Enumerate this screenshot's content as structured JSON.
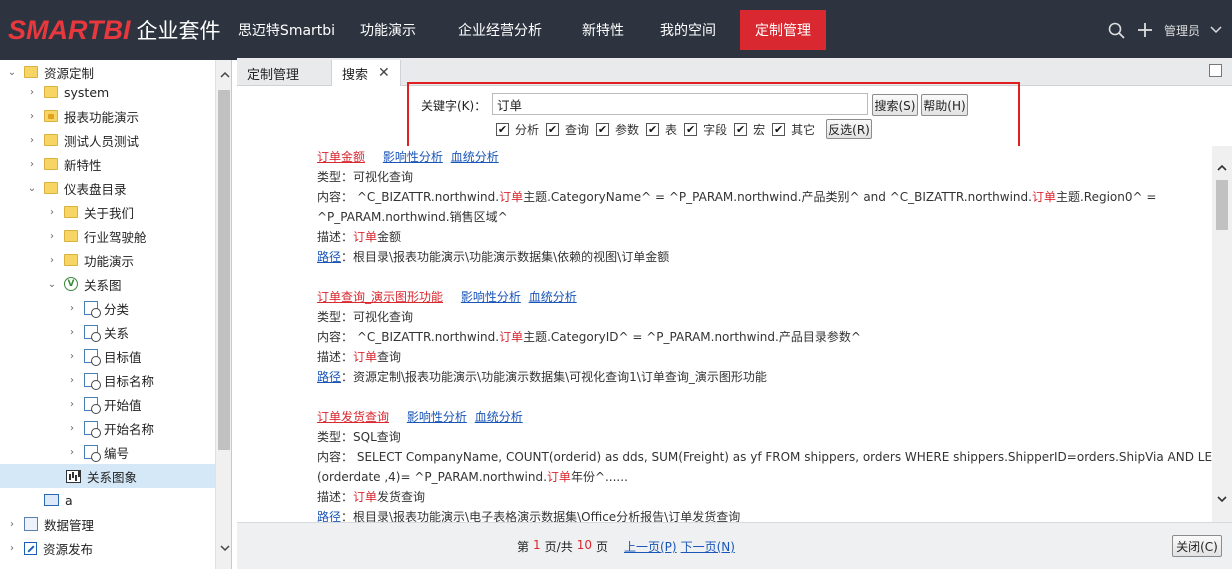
{
  "header": {
    "logo_brand": "SMARTBI",
    "logo_suffix": "企业套件",
    "nav": [
      {
        "label": "思迈特Smartbi",
        "active": false
      },
      {
        "label": "功能演示",
        "active": false
      },
      {
        "label": "企业经营分析",
        "active": false
      },
      {
        "label": "新特性",
        "active": false
      },
      {
        "label": "我的空间",
        "active": false
      },
      {
        "label": "定制管理",
        "active": true
      }
    ],
    "user": "管理员",
    "accent_color": "#d9282f",
    "bar_color": "#2d3440"
  },
  "tree": {
    "items": [
      {
        "label": "资源定制",
        "icon": "folder-icon",
        "expanded": true
      },
      {
        "label": "system",
        "icon": "folder-icon"
      },
      {
        "label": "报表功能演示",
        "icon": "locked-folder-icon"
      },
      {
        "label": "测试人员测试",
        "icon": "folder-icon"
      },
      {
        "label": "新特性",
        "icon": "folder-icon"
      },
      {
        "label": "仪表盘目录",
        "icon": "folder-icon",
        "expanded": true
      },
      {
        "label": "关于我们",
        "icon": "folder-icon"
      },
      {
        "label": "行业驾驶舱",
        "icon": "folder-icon"
      },
      {
        "label": "功能演示",
        "icon": "folder-icon"
      },
      {
        "label": "关系图",
        "icon": "visualization-icon",
        "expanded": true
      },
      {
        "label": "分类",
        "icon": "query-icon"
      },
      {
        "label": "关系",
        "icon": "query-icon"
      },
      {
        "label": "目标值",
        "icon": "query-icon"
      },
      {
        "label": "目标名称",
        "icon": "query-icon"
      },
      {
        "label": "开始值",
        "icon": "query-icon"
      },
      {
        "label": "开始名称",
        "icon": "query-icon"
      },
      {
        "label": "编号",
        "icon": "query-icon"
      },
      {
        "label": "关系图象",
        "icon": "chart-icon",
        "selected": true
      },
      {
        "label": "a",
        "icon": "report-icon"
      },
      {
        "label": "数据管理",
        "icon": "document-icon"
      },
      {
        "label": "资源发布",
        "icon": "publish-icon"
      }
    ]
  },
  "tabs": [
    {
      "label": "定制管理",
      "active": false
    },
    {
      "label": "搜索",
      "active": true
    }
  ],
  "search": {
    "keyword_label": "关键字(K)：",
    "keyword_value": "订单",
    "search_button": "搜索(S)",
    "help_button": "帮助(H)",
    "invert_button": "反选(R)",
    "options": [
      {
        "label": "分析",
        "checked": true
      },
      {
        "label": "查询",
        "checked": true
      },
      {
        "label": "参数",
        "checked": true
      },
      {
        "label": "表",
        "checked": true
      },
      {
        "label": "字段",
        "checked": true
      },
      {
        "label": "宏",
        "checked": true
      },
      {
        "label": "其它",
        "checked": true
      }
    ]
  },
  "results": [
    {
      "title": "订单金额",
      "impact_link": "影响性分析",
      "lineage_link": "血统分析",
      "type_label": "类型：",
      "type_value": "可视化查询",
      "content_label": "内容：",
      "content_1": " ^C_BIZATTR.northwind.",
      "content_hl1": "订单",
      "content_2": "主题.CategoryName^ = ^P_PARAM.northwind.产品类别^ and ^C_BIZATTR.northwind.",
      "content_hl2": "订单",
      "content_3": "主题.Region0^ =",
      "content_line2": "^P_PARAM.northwind.销售区域^",
      "desc_label": "描述：",
      "desc_hl": "订单",
      "desc_rest": "金额",
      "path_label": "路径",
      "path_value": "：根目录\\报表功能演示\\功能演示数据集\\依赖的视图\\订单金额"
    },
    {
      "title": "订单查询_演示图形功能",
      "impact_link": "影响性分析",
      "lineage_link": "血统分析",
      "type_label": "类型：",
      "type_value": "可视化查询",
      "content_label": "内容：",
      "content_1": " ^C_BIZATTR.northwind.",
      "content_hl1": "订单",
      "content_2": "主题.CategoryID^ = ^P_PARAM.northwind.产品目录参数^",
      "desc_label": "描述：",
      "desc_hl": "订单",
      "desc_rest": "查询",
      "path_label": "路径",
      "path_value": "：资源定制\\报表功能演示\\功能演示数据集\\可视化查询1\\订单查询_演示图形功能"
    },
    {
      "title": "订单发货查询",
      "impact_link": "影响性分析",
      "lineage_link": "血统分析",
      "type_label": "类型：",
      "type_value": "SQL查询",
      "content_label": "内容：",
      "content_1": " SELECT CompanyName, COUNT(orderid) as dds, SUM(Freight) as yf FROM shippers, orders WHERE shippers.ShipperID=orders.ShipVia AND LEFT",
      "content_line2a": "(orderdate ,4)= ^P_PARAM.northwind.",
      "content_line2_hl": "订单",
      "content_line2b": "年份^......",
      "desc_label": "描述：",
      "desc_hl": "订单",
      "desc_rest": "发货查询",
      "path_label": "路径",
      "path_value": "：根目录\\报表功能演示\\电子表格演示数据集\\Office分析报告\\订单发货查询"
    }
  ],
  "pager": {
    "prefix": "第",
    "current": "1",
    "mid": "页/共",
    "total": "10",
    "suffix": "页",
    "prev": "上一页(P)",
    "next": "下一页(N)"
  },
  "close_button": "关闭(C)"
}
